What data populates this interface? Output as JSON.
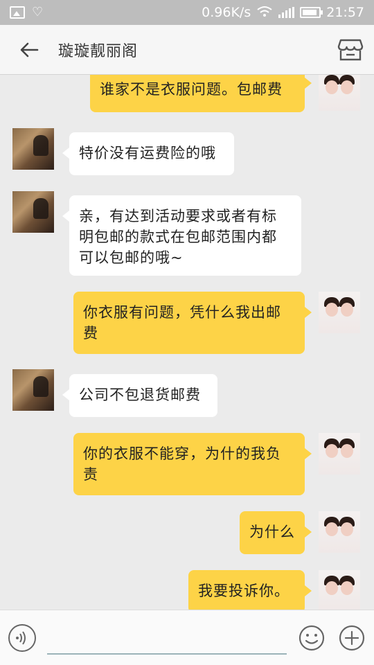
{
  "status_bar": {
    "net_speed": "0.96K/s",
    "time": "21:57",
    "icons": [
      "image-icon",
      "heart-icon",
      "wifi-icon",
      "signal-icon",
      "battery-icon"
    ]
  },
  "header": {
    "back_icon": "arrow-left-icon",
    "title": "璇璇靓丽阁",
    "shop_icon": "store-icon"
  },
  "messages": [
    {
      "side": "right",
      "text": "谁家不是衣服问题。包邮费"
    },
    {
      "side": "left",
      "text": "特价没有运费险的哦"
    },
    {
      "side": "left",
      "text": "亲，有达到活动要求或者有标明包邮的款式在包邮范围内都可以包邮的哦~"
    },
    {
      "side": "right",
      "text": "你衣服有问题，凭什么我出邮费"
    },
    {
      "side": "left",
      "text": "公司不包退货邮费"
    },
    {
      "side": "right",
      "text": "你的衣服不能穿，为什的我负责"
    },
    {
      "side": "right",
      "text": "为什么"
    },
    {
      "side": "right",
      "text": "我要投诉你。"
    }
  ],
  "input_bar": {
    "voice_icon": "voice-icon",
    "input_value": "",
    "emoji_icon": "smiley-icon",
    "plus_icon": "plus-icon"
  },
  "colors": {
    "bubble_yellow": "#fdd347",
    "bubble_white": "#ffffff",
    "background": "#ebebeb"
  }
}
